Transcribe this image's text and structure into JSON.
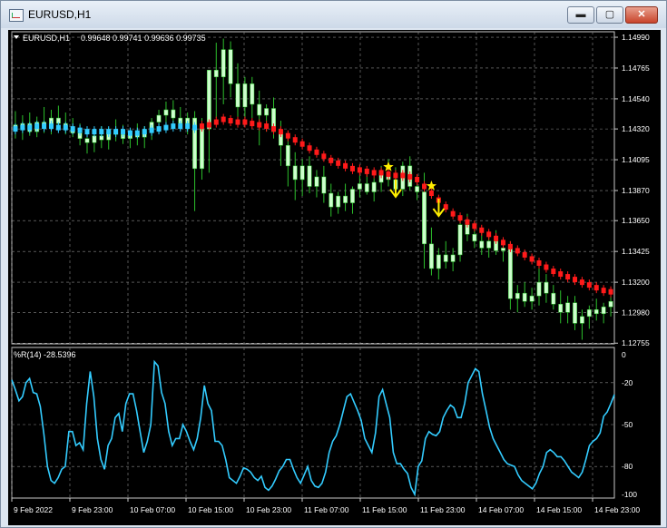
{
  "window": {
    "title": "EURUSD,H1",
    "buttons": {
      "minimize": "▬",
      "maximize": "▢",
      "close": "✕"
    }
  },
  "main_chart": {
    "symbol_label": "EURUSD,H1",
    "ohlc": "0.99648 0.99741 0.99636 0.99735",
    "y_ticks": [
      "1.14990",
      "1.14765",
      "1.14540",
      "1.14320",
      "1.14095",
      "1.13870",
      "1.13650",
      "1.13425",
      "1.13200",
      "1.12980",
      "1.12755"
    ]
  },
  "sub_chart": {
    "label": "%R(14) -28.5396",
    "y_ticks": [
      "0",
      "-20",
      "-50",
      "-80",
      "-100"
    ]
  },
  "x_axis_ticks": [
    "9 Feb 2022",
    "9 Feb 23:00",
    "10 Feb 07:00",
    "10 Feb 15:00",
    "10 Feb 23:00",
    "11 Feb 07:00",
    "11 Feb 15:00",
    "11 Feb 23:00",
    "14 Feb 07:00",
    "14 Feb 15:00",
    "14 Feb 23:00"
  ],
  "colors": {
    "background": "#000000",
    "candle": "#ccffcc",
    "wick": "#2cbf2c",
    "trend_down": "#ff1a1a",
    "trend_up": "#33ccff",
    "williams_r": "#33ccff",
    "signal": "#ffee00",
    "grid": "#8a8a8a",
    "text": "#ffffff"
  },
  "chart_data": [
    {
      "type": "candlestick",
      "title": "EURUSD,H1",
      "ylim": [
        1.1275,
        1.1503
      ],
      "grid": true,
      "candles": [
        {
          "o": 1.1435,
          "h": 1.1445,
          "l": 1.1425,
          "c": 1.1432
        },
        {
          "o": 1.1432,
          "h": 1.1442,
          "l": 1.1424,
          "c": 1.1436
        },
        {
          "o": 1.1436,
          "h": 1.1444,
          "l": 1.1427,
          "c": 1.143
        },
        {
          "o": 1.143,
          "h": 1.1441,
          "l": 1.1426,
          "c": 1.1437
        },
        {
          "o": 1.1437,
          "h": 1.1448,
          "l": 1.1429,
          "c": 1.1434
        },
        {
          "o": 1.1434,
          "h": 1.1446,
          "l": 1.1428,
          "c": 1.144
        },
        {
          "o": 1.144,
          "h": 1.1449,
          "l": 1.1431,
          "c": 1.1436
        },
        {
          "o": 1.1436,
          "h": 1.1444,
          "l": 1.1428,
          "c": 1.1432
        },
        {
          "o": 1.1432,
          "h": 1.144,
          "l": 1.1426,
          "c": 1.1429
        },
        {
          "o": 1.1429,
          "h": 1.1436,
          "l": 1.142,
          "c": 1.1425
        },
        {
          "o": 1.1425,
          "h": 1.1432,
          "l": 1.1414,
          "c": 1.1422
        },
        {
          "o": 1.1422,
          "h": 1.143,
          "l": 1.1415,
          "c": 1.1427
        },
        {
          "o": 1.1427,
          "h": 1.1434,
          "l": 1.1418,
          "c": 1.1424
        },
        {
          "o": 1.1424,
          "h": 1.1433,
          "l": 1.1417,
          "c": 1.143
        },
        {
          "o": 1.143,
          "h": 1.1439,
          "l": 1.1423,
          "c": 1.1428
        },
        {
          "o": 1.1428,
          "h": 1.1435,
          "l": 1.1421,
          "c": 1.1425
        },
        {
          "o": 1.1425,
          "h": 1.1432,
          "l": 1.1418,
          "c": 1.1428
        },
        {
          "o": 1.1428,
          "h": 1.1436,
          "l": 1.142,
          "c": 1.1426
        },
        {
          "o": 1.1426,
          "h": 1.1434,
          "l": 1.1418,
          "c": 1.1431
        },
        {
          "o": 1.1431,
          "h": 1.144,
          "l": 1.1424,
          "c": 1.1437
        },
        {
          "o": 1.1437,
          "h": 1.1446,
          "l": 1.1429,
          "c": 1.1442
        },
        {
          "o": 1.1442,
          "h": 1.1452,
          "l": 1.1433,
          "c": 1.1446
        },
        {
          "o": 1.1446,
          "h": 1.1453,
          "l": 1.1435,
          "c": 1.144
        },
        {
          "o": 1.144,
          "h": 1.1448,
          "l": 1.1432,
          "c": 1.1436
        },
        {
          "o": 1.1436,
          "h": 1.1444,
          "l": 1.1428,
          "c": 1.144
        },
        {
          "o": 1.144,
          "h": 1.1445,
          "l": 1.1372,
          "c": 1.1403
        },
        {
          "o": 1.1403,
          "h": 1.144,
          "l": 1.1395,
          "c": 1.1432
        },
        {
          "o": 1.1432,
          "h": 1.146,
          "l": 1.14,
          "c": 1.1475
        },
        {
          "o": 1.1475,
          "h": 1.1495,
          "l": 1.144,
          "c": 1.147
        },
        {
          "o": 1.147,
          "h": 1.1498,
          "l": 1.145,
          "c": 1.149
        },
        {
          "o": 1.149,
          "h": 1.1496,
          "l": 1.1455,
          "c": 1.1465
        },
        {
          "o": 1.1465,
          "h": 1.148,
          "l": 1.144,
          "c": 1.1448
        },
        {
          "o": 1.1448,
          "h": 1.147,
          "l": 1.144,
          "c": 1.1465
        },
        {
          "o": 1.1465,
          "h": 1.147,
          "l": 1.144,
          "c": 1.145
        },
        {
          "o": 1.145,
          "h": 1.146,
          "l": 1.142,
          "c": 1.1442
        },
        {
          "o": 1.1442,
          "h": 1.145,
          "l": 1.143,
          "c": 1.1447
        },
        {
          "o": 1.1447,
          "h": 1.1455,
          "l": 1.1425,
          "c": 1.143
        },
        {
          "o": 1.143,
          "h": 1.1438,
          "l": 1.1405,
          "c": 1.142
        },
        {
          "o": 1.142,
          "h": 1.1428,
          "l": 1.139,
          "c": 1.1405
        },
        {
          "o": 1.1405,
          "h": 1.1415,
          "l": 1.138,
          "c": 1.1395
        },
        {
          "o": 1.1395,
          "h": 1.141,
          "l": 1.1383,
          "c": 1.1405
        },
        {
          "o": 1.1405,
          "h": 1.1412,
          "l": 1.1385,
          "c": 1.139
        },
        {
          "o": 1.139,
          "h": 1.1402,
          "l": 1.1382,
          "c": 1.1397
        },
        {
          "o": 1.1397,
          "h": 1.1405,
          "l": 1.1378,
          "c": 1.1385
        },
        {
          "o": 1.1385,
          "h": 1.1392,
          "l": 1.1368,
          "c": 1.1375
        },
        {
          "o": 1.1375,
          "h": 1.1386,
          "l": 1.137,
          "c": 1.1383
        },
        {
          "o": 1.1383,
          "h": 1.1392,
          "l": 1.1372,
          "c": 1.1378
        },
        {
          "o": 1.1378,
          "h": 1.139,
          "l": 1.137,
          "c": 1.1388
        },
        {
          "o": 1.1388,
          "h": 1.1398,
          "l": 1.1382,
          "c": 1.1392
        },
        {
          "o": 1.1392,
          "h": 1.1402,
          "l": 1.1384,
          "c": 1.1386
        },
        {
          "o": 1.1386,
          "h": 1.1396,
          "l": 1.1379,
          "c": 1.1393
        },
        {
          "o": 1.1393,
          "h": 1.1405,
          "l": 1.1386,
          "c": 1.14
        },
        {
          "o": 1.14,
          "h": 1.141,
          "l": 1.139,
          "c": 1.1395
        },
        {
          "o": 1.1395,
          "h": 1.1404,
          "l": 1.1383,
          "c": 1.1388
        },
        {
          "o": 1.1388,
          "h": 1.1408,
          "l": 1.1383,
          "c": 1.1405
        },
        {
          "o": 1.1405,
          "h": 1.1412,
          "l": 1.1387,
          "c": 1.139
        },
        {
          "o": 1.139,
          "h": 1.1398,
          "l": 1.138,
          "c": 1.1386
        },
        {
          "o": 1.1386,
          "h": 1.14,
          "l": 1.133,
          "c": 1.1348
        },
        {
          "o": 1.1348,
          "h": 1.136,
          "l": 1.1325,
          "c": 1.133
        },
        {
          "o": 1.133,
          "h": 1.1345,
          "l": 1.1322,
          "c": 1.134
        },
        {
          "o": 1.134,
          "h": 1.135,
          "l": 1.133,
          "c": 1.1335
        },
        {
          "o": 1.1335,
          "h": 1.1345,
          "l": 1.1328,
          "c": 1.134
        },
        {
          "o": 1.134,
          "h": 1.1365,
          "l": 1.1335,
          "c": 1.1362
        },
        {
          "o": 1.1362,
          "h": 1.137,
          "l": 1.135,
          "c": 1.1355
        },
        {
          "o": 1.1355,
          "h": 1.1364,
          "l": 1.1345,
          "c": 1.135
        },
        {
          "o": 1.135,
          "h": 1.136,
          "l": 1.134,
          "c": 1.1345
        },
        {
          "o": 1.1345,
          "h": 1.1355,
          "l": 1.1338,
          "c": 1.135
        },
        {
          "o": 1.135,
          "h": 1.1358,
          "l": 1.134,
          "c": 1.1343
        },
        {
          "o": 1.1343,
          "h": 1.135,
          "l": 1.1335,
          "c": 1.1345
        },
        {
          "o": 1.1345,
          "h": 1.135,
          "l": 1.13,
          "c": 1.1308
        },
        {
          "o": 1.1308,
          "h": 1.1318,
          "l": 1.1298,
          "c": 1.1312
        },
        {
          "o": 1.1312,
          "h": 1.132,
          "l": 1.1302,
          "c": 1.1306
        },
        {
          "o": 1.1306,
          "h": 1.1316,
          "l": 1.13,
          "c": 1.131
        },
        {
          "o": 1.131,
          "h": 1.133,
          "l": 1.1303,
          "c": 1.132
        },
        {
          "o": 1.132,
          "h": 1.1326,
          "l": 1.1305,
          "c": 1.1312
        },
        {
          "o": 1.1312,
          "h": 1.1318,
          "l": 1.13,
          "c": 1.1304
        },
        {
          "o": 1.1304,
          "h": 1.1314,
          "l": 1.129,
          "c": 1.1298
        },
        {
          "o": 1.1298,
          "h": 1.131,
          "l": 1.129,
          "c": 1.1305
        },
        {
          "o": 1.1305,
          "h": 1.131,
          "l": 1.1285,
          "c": 1.129
        },
        {
          "o": 1.129,
          "h": 1.13,
          "l": 1.1278,
          "c": 1.1295
        },
        {
          "o": 1.1295,
          "h": 1.1303,
          "l": 1.1286,
          "c": 1.13
        },
        {
          "o": 1.13,
          "h": 1.1308,
          "l": 1.1292,
          "c": 1.1297
        },
        {
          "o": 1.1297,
          "h": 1.1305,
          "l": 1.129,
          "c": 1.1302
        },
        {
          "o": 1.1302,
          "h": 1.131,
          "l": 1.1295,
          "c": 1.1306
        }
      ],
      "trend_line": {
        "up_until_index": 26,
        "values": [
          1.1432,
          1.1433,
          1.1433,
          1.1434,
          1.1434,
          1.1434,
          1.1433,
          1.1433,
          1.1432,
          1.1431,
          1.143,
          1.143,
          1.143,
          1.143,
          1.143,
          1.143,
          1.1429,
          1.1429,
          1.143,
          1.1431,
          1.1432,
          1.1433,
          1.1434,
          1.1434,
          1.1434,
          1.1433,
          1.1434,
          1.1435,
          1.1437,
          1.1439,
          1.1438,
          1.1437,
          1.1437,
          1.1436,
          1.1435,
          1.1434,
          1.1432,
          1.143,
          1.1427,
          1.1424,
          1.1421,
          1.1418,
          1.1415,
          1.1412,
          1.1409,
          1.1407,
          1.1405,
          1.1403,
          1.1402,
          1.1401,
          1.14,
          1.14,
          1.1399,
          1.1398,
          1.1398,
          1.1397,
          1.1395,
          1.139,
          1.1385,
          1.138,
          1.1375,
          1.137,
          1.1367,
          1.1364,
          1.1361,
          1.1358,
          1.1355,
          1.1352,
          1.1349,
          1.1346,
          1.1343,
          1.134,
          1.1337,
          1.1334,
          1.1331,
          1.1328,
          1.1326,
          1.1324,
          1.1322,
          1.132,
          1.1318,
          1.1316,
          1.1314,
          1.1313
        ]
      },
      "signals": [
        {
          "index": 52,
          "type": "sell"
        },
        {
          "index": 58,
          "type": "sell"
        }
      ]
    },
    {
      "type": "line",
      "title": "%R(14) -28.5396",
      "ylim": [
        -100,
        0
      ],
      "series": [
        {
          "name": "%R(14)",
          "values": [
            -18,
            -25,
            -33,
            -30,
            -20,
            -17,
            -27,
            -28,
            -37,
            -57,
            -80,
            -90,
            -92,
            -88,
            -82,
            -80,
            -55,
            -55,
            -65,
            -63,
            -68,
            -35,
            -12,
            -30,
            -60,
            -75,
            -82,
            -65,
            -60,
            -45,
            -42,
            -55,
            -35,
            -28,
            -28,
            -40,
            -55,
            -70,
            -62,
            -50,
            -5,
            -8,
            -27,
            -35,
            -55,
            -65,
            -60,
            -60,
            -50,
            -55,
            -62,
            -68,
            -60,
            -45,
            -22,
            -35,
            -40,
            -62,
            -62,
            -65,
            -75,
            -88,
            -90,
            -92,
            -87,
            -81,
            -82,
            -84,
            -88,
            -90,
            -87,
            -95,
            -97,
            -94,
            -89,
            -83,
            -80,
            -75,
            -75,
            -82,
            -88,
            -92,
            -86,
            -80,
            -90,
            -94,
            -95,
            -92,
            -84,
            -70,
            -62,
            -58,
            -50,
            -40,
            -30,
            -28,
            -34,
            -40,
            -47,
            -60,
            -65,
            -70,
            -56,
            -30,
            -25,
            -35,
            -45,
            -70,
            -78,
            -78,
            -82,
            -85,
            -95,
            -100,
            -80,
            -76,
            -60,
            -55,
            -57,
            -58,
            -55,
            -45,
            -40,
            -36,
            -38,
            -45,
            -45,
            -35,
            -20,
            -15,
            -10,
            -12,
            -28,
            -40,
            -52,
            -60,
            -65,
            -70,
            -75,
            -78,
            -79,
            -80,
            -86,
            -90,
            -92,
            -94,
            -96,
            -92,
            -85,
            -80,
            -70,
            -68,
            -70,
            -73,
            -73,
            -76,
            -80,
            -84,
            -86,
            -88,
            -84,
            -75,
            -65,
            -62,
            -60,
            -56,
            -44,
            -41,
            -35,
            -28.5
          ]
        }
      ]
    }
  ]
}
